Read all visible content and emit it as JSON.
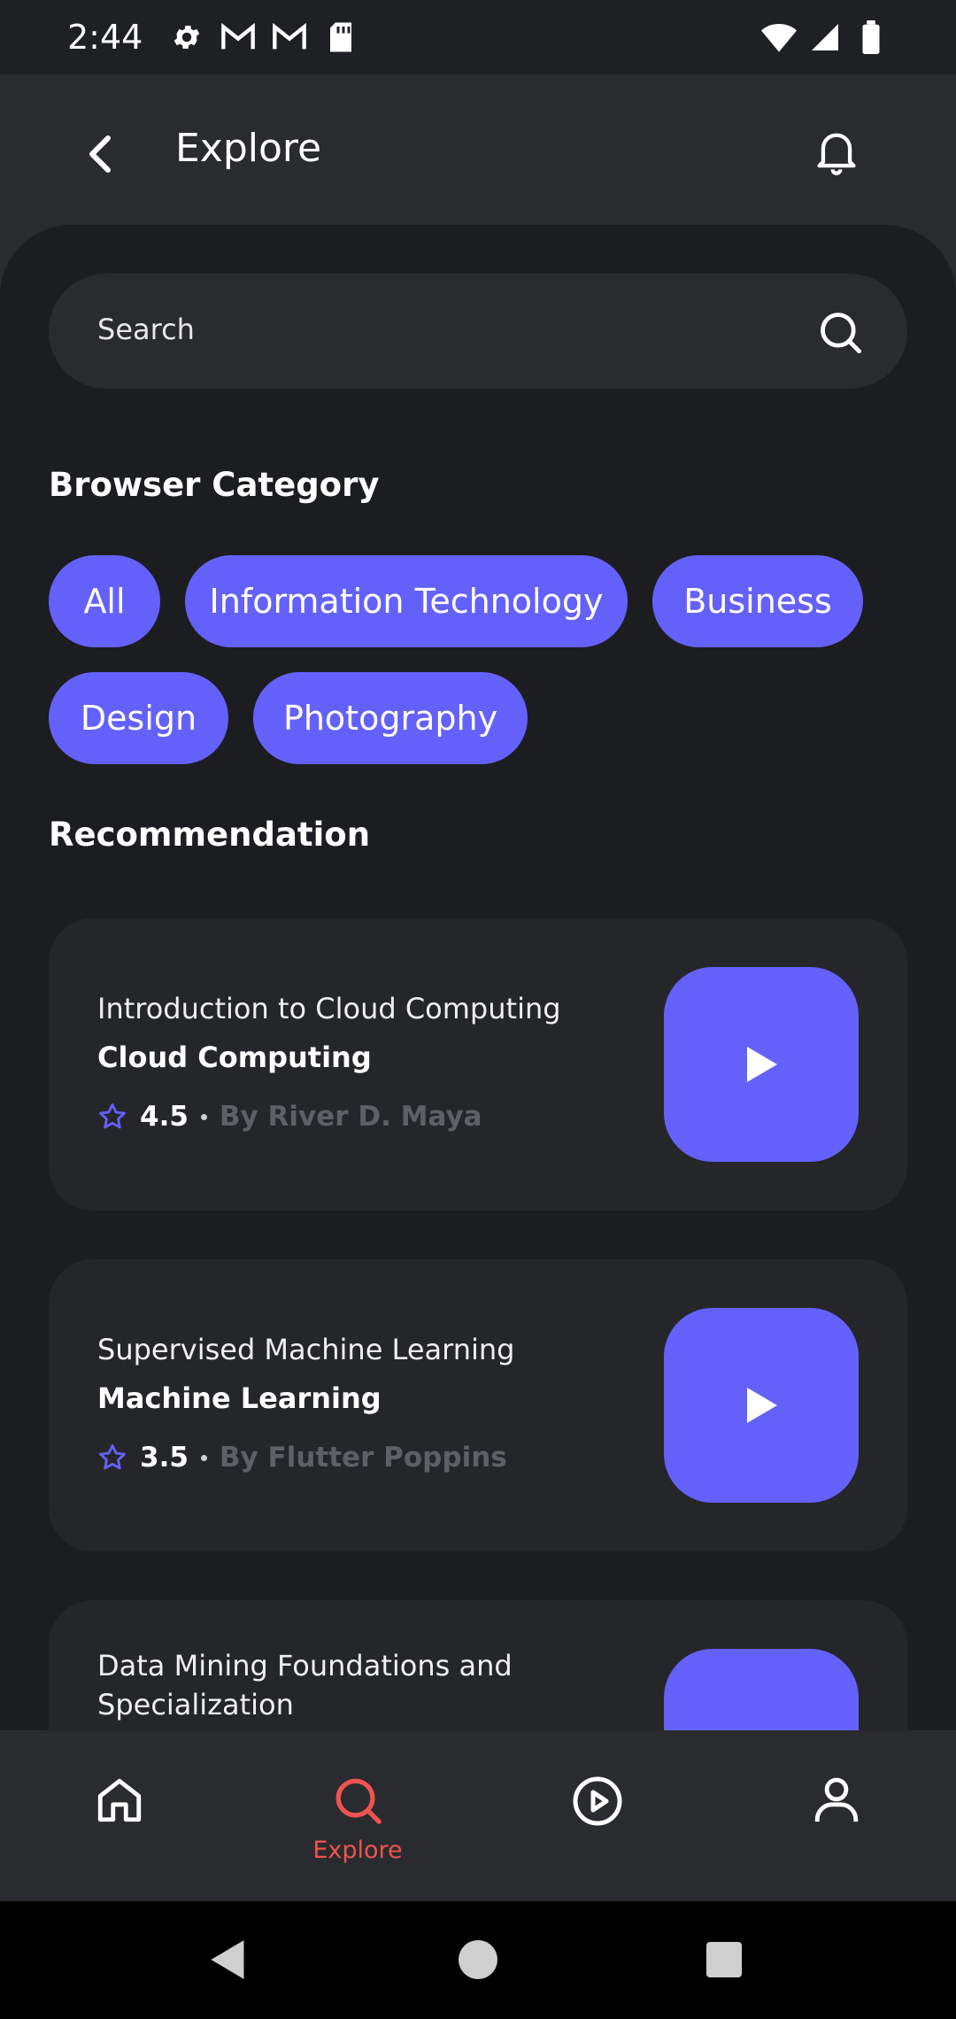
{
  "status_bar": {
    "time": "2:44",
    "left_icons": [
      "gear-icon",
      "gmail-icon",
      "gmail-icon",
      "sd-card-icon"
    ],
    "right_icons": [
      "wifi-icon",
      "signal-icon",
      "battery-icon"
    ]
  },
  "header": {
    "title": "Explore"
  },
  "search": {
    "placeholder": "Search"
  },
  "categories": {
    "title": "Browser Category",
    "chips": [
      "All",
      "Information Technology",
      "Business",
      "Design",
      "Photography"
    ]
  },
  "recommendation": {
    "title": "Recommendation",
    "cards": [
      {
        "subtitle": "Introduction to Cloud Computing",
        "title": "Cloud Computing",
        "rating": "4.5",
        "author": "By River D. Maya"
      },
      {
        "subtitle": "Supervised Machine Learning",
        "title": "Machine Learning",
        "rating": "3.5",
        "author": "By Flutter Poppins"
      },
      {
        "subtitle": "Data Mining Foundations and Specialization"
      }
    ]
  },
  "bottom_nav": {
    "items": [
      {
        "icon": "home-icon",
        "label": ""
      },
      {
        "icon": "search-icon",
        "label": "Explore",
        "active": true
      },
      {
        "icon": "play-circle-icon",
        "label": ""
      },
      {
        "icon": "profile-icon",
        "label": ""
      }
    ]
  },
  "colors": {
    "accent": "#6461fb",
    "active_nav": "#ef5350",
    "background": "#1c1d20",
    "surface": "#2a2b2e"
  }
}
